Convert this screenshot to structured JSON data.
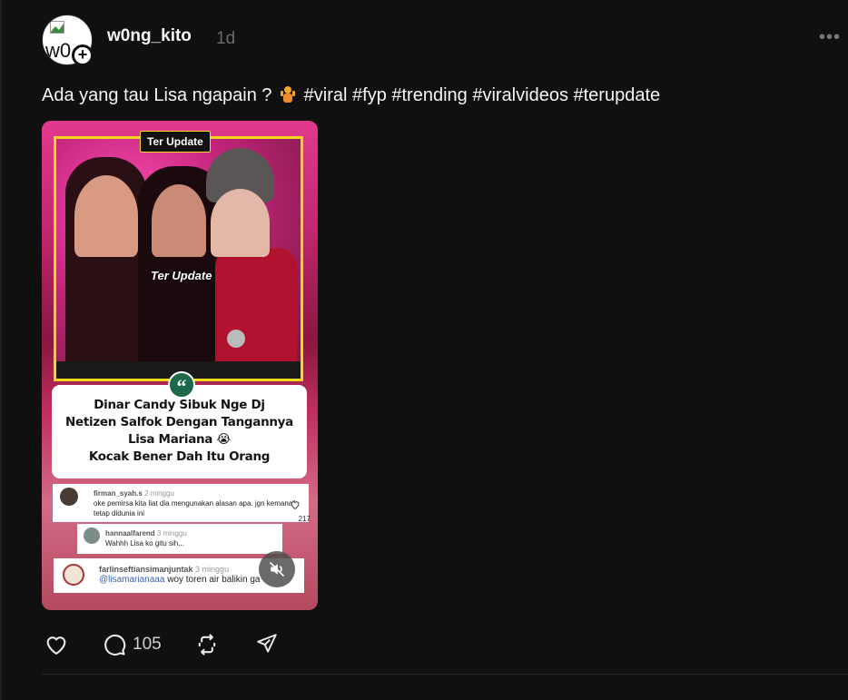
{
  "post": {
    "avatar_alt": "w0",
    "username": "w0ng_kito",
    "timestamp": "1d",
    "more_label": "•••",
    "caption_before": "Ada yang tau Lisa ngapain ?",
    "caption_hashtags": "#viral #fyp #trending #viralvideos #terupdate",
    "comment_count": "105"
  },
  "media": {
    "tag": "Ter Update",
    "watermark": "Ter Update",
    "headline_lines": [
      "Dinar Candy Sibuk Nge Dj",
      "Netizen Salfok Dengan Tangannya",
      "Lisa Mariana 😭",
      "Kocak Bener Dah Itu Orang"
    ],
    "comments": [
      {
        "user": "firman_syah.s",
        "ago": "2 minggu",
        "text": "oke pemirsa kita liat dia mengunakan alasan apa. jgn kemana\" tetap didunia ini",
        "likes": "217"
      },
      {
        "user": "hannaalfarend",
        "ago": "3 minggu",
        "text": "Wahhh Lisa ko gitu sih..."
      },
      {
        "user": "farlinseftiansimanjuntak",
        "ago": "3 minggu",
        "mention": "@lisamarianaaa",
        "text": " woy toren air balikin ga"
      }
    ]
  },
  "icons": {
    "avatar": "broken-image-icon",
    "follow": "plus-icon",
    "more": "more-icon",
    "like": "heart-icon",
    "comment": "comment-icon",
    "repost": "repost-icon",
    "share": "send-icon",
    "mute": "mute-icon"
  },
  "colors": {
    "background": "#101010",
    "text": "#f3f5f7",
    "muted": "#6b6b6b",
    "tag_border": "#f7da19"
  }
}
